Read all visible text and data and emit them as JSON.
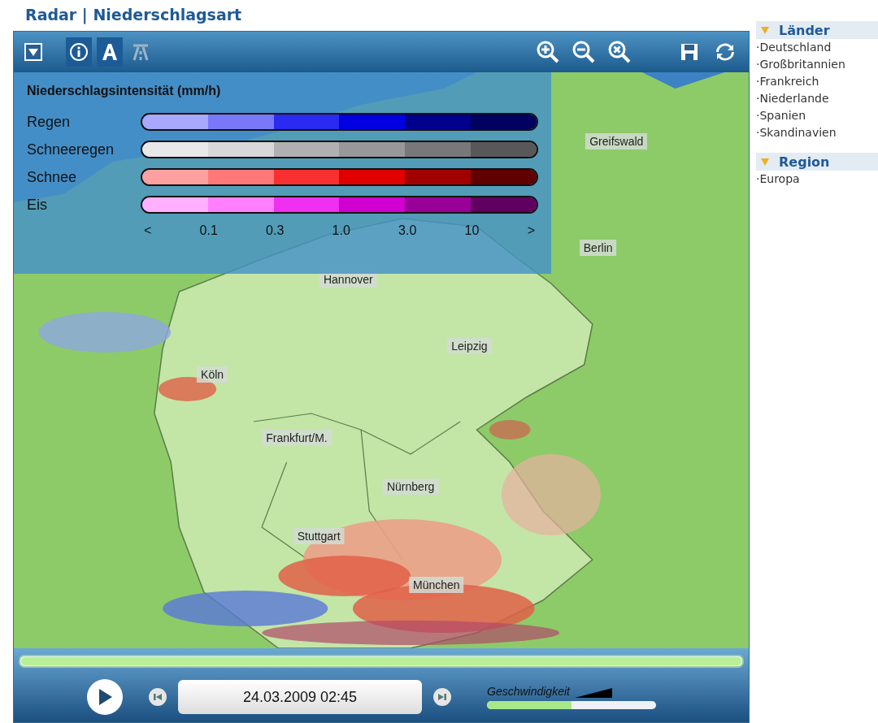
{
  "title": "Radar | Niederschlagsart",
  "toolbar": {
    "left": [
      {
        "kind": "dropdown",
        "selected": false
      },
      {
        "kind": "info",
        "selected": true
      },
      {
        "kind": "labels",
        "selected": true
      },
      {
        "kind": "roads",
        "selected": false
      }
    ],
    "right": [
      {
        "kind": "zoom-in"
      },
      {
        "kind": "zoom-out"
      },
      {
        "kind": "zoom-reset"
      },
      {
        "kind": "save"
      },
      {
        "kind": "refresh"
      }
    ]
  },
  "legend": {
    "title": "Niederschlagsintensität (mm/h)",
    "rows": [
      {
        "name": "Regen"
      },
      {
        "name": "Schneeregen"
      },
      {
        "name": "Schnee"
      },
      {
        "name": "Eis"
      }
    ],
    "ticks": [
      "<",
      "0.1",
      "0.3",
      "1.0",
      "3.0",
      "10",
      ">"
    ]
  },
  "cities": [
    {
      "name": "Greifswald"
    },
    {
      "name": "Berlin"
    },
    {
      "name": "Hannover"
    },
    {
      "name": "Leipzig"
    },
    {
      "name": "Köln"
    },
    {
      "name": "Frankfurt/M."
    },
    {
      "name": "Nürnberg"
    },
    {
      "name": "Stuttgart"
    },
    {
      "name": "München"
    }
  ],
  "timeline": {
    "level": 1
  },
  "player": {
    "date": "24.03.2009 02:45",
    "speed_label": "Geschwindigkeit",
    "speed": {
      "level": 0.5
    }
  },
  "sidebar": [
    {
      "title": "Länder",
      "items": [
        "·Deutschland",
        "·Großbritannien",
        "·Frankreich",
        "·Niederlande",
        "·Spanien",
        "·Skandinavien"
      ]
    },
    {
      "title": "Region",
      "items": [
        "·Europa"
      ]
    }
  ]
}
